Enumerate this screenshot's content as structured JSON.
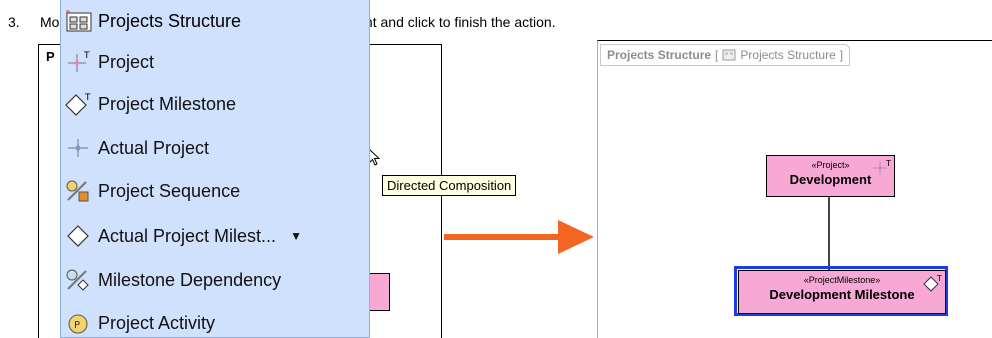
{
  "step": {
    "number": "3.",
    "text_visible_left": "Mo",
    "text_visible_right": "get element and click to finish the action."
  },
  "left_diagram": {
    "corner_label": "P",
    "tooltip": "Directed Composition"
  },
  "palette": {
    "title": "Projects Structure",
    "items": [
      {
        "label": "Project",
        "icon": "project-icon"
      },
      {
        "label": "Project Milestone",
        "icon": "milestone-icon"
      },
      {
        "label": "Actual Project",
        "icon": "actual-project-icon"
      },
      {
        "label": "Project Sequence",
        "icon": "sequence-icon"
      },
      {
        "label": "Actual Project Milest...",
        "icon": "actual-milestone-icon",
        "has_dropdown": true
      },
      {
        "label": "Milestone Dependency",
        "icon": "dependency-icon"
      },
      {
        "label": "Project Activity",
        "icon": "activity-icon"
      }
    ]
  },
  "right_diagram": {
    "header_bold": "Projects Structure",
    "header_bracket_open": "[",
    "header_name": "Projects Structure",
    "header_bracket_close": "]",
    "project_node": {
      "stereotype": "«Project»",
      "name": "Development",
      "corner_mark": "T"
    },
    "milestone_node": {
      "stereotype": "«ProjectMilestone»",
      "name": "Development Milestone",
      "corner_mark": "T"
    }
  },
  "colors": {
    "palette_bg": "#cfe1fc",
    "node_fill": "#f7a8d4",
    "selection": "#1f38e8",
    "arrow": "#f26522",
    "tooltip_bg": "#ffffe1"
  }
}
